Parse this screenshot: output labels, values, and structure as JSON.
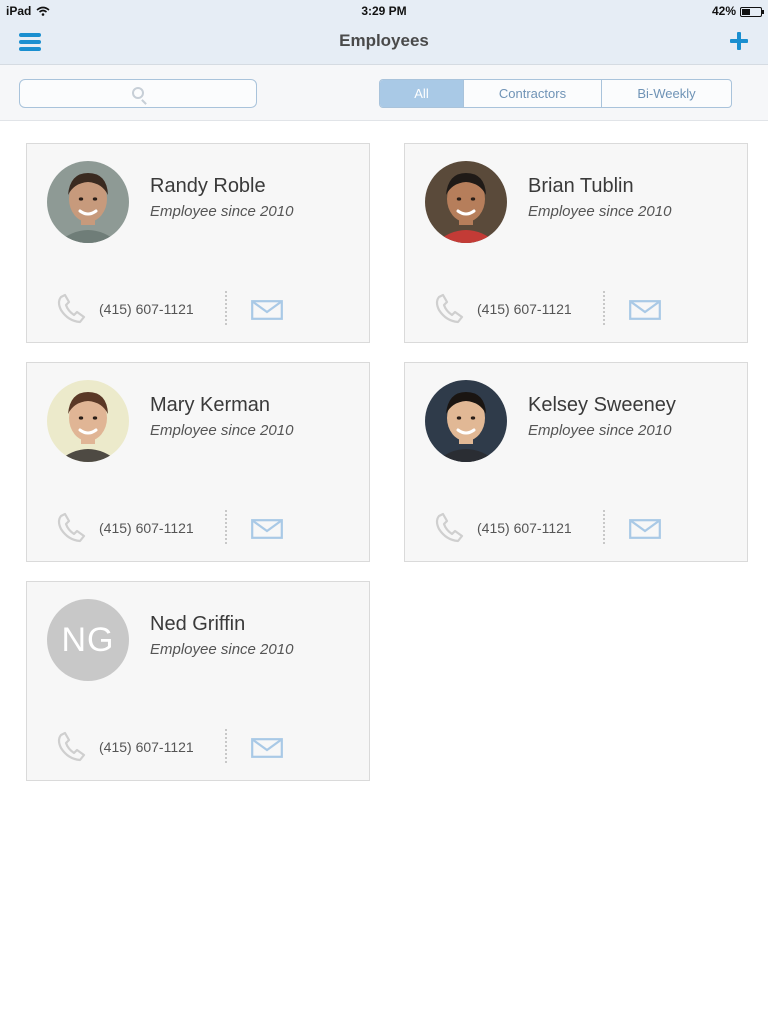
{
  "status_bar": {
    "device": "iPad",
    "time": "3:29 PM",
    "battery": "42%",
    "battery_level": 0.42
  },
  "nav": {
    "title": "Employees"
  },
  "search": {
    "placeholder": ""
  },
  "filters": [
    {
      "label": "All",
      "active": true
    },
    {
      "label": "Contractors",
      "active": false
    },
    {
      "label": "Bi-Weekly",
      "active": false
    }
  ],
  "employees": [
    {
      "name": "Randy Roble",
      "since": "Employee since 2010",
      "phone": "(415) 607-1121",
      "avatar": "photo",
      "skin": "#c79a7c",
      "hair": "#3a2a20",
      "bg": "#8e9a95",
      "shirt": "#6f7d78"
    },
    {
      "name": "Brian Tublin",
      "since": "Employee since 2010",
      "phone": "(415) 607-1121",
      "avatar": "photo",
      "skin": "#b67e5b",
      "hair": "#1f1a17",
      "bg": "#5a4a3a",
      "shirt": "#c33b36"
    },
    {
      "name": "Mary Kerman",
      "since": "Employee since 2010",
      "phone": "(415) 607-1121",
      "avatar": "photo",
      "skin": "#e0b595",
      "hair": "#5a3826",
      "bg": "#eceacb",
      "shirt": "#4e4a43"
    },
    {
      "name": "Kelsey Sweeney",
      "since": "Employee since 2010",
      "phone": "(415) 607-1121",
      "avatar": "photo",
      "skin": "#e1b895",
      "hair": "#1a1512",
      "bg": "#2f3b4a",
      "shirt": "#2a2d33"
    },
    {
      "name": "Ned Griffin",
      "since": "Employee since 2010",
      "phone": "(415) 607-1121",
      "avatar": "initials",
      "initials": "NG"
    }
  ],
  "colors": {
    "accent": "#1a8fd0",
    "segment_active": "#a9c9e6",
    "icon_muted": "#c7cfd7",
    "mail": "#a9c9e6"
  }
}
